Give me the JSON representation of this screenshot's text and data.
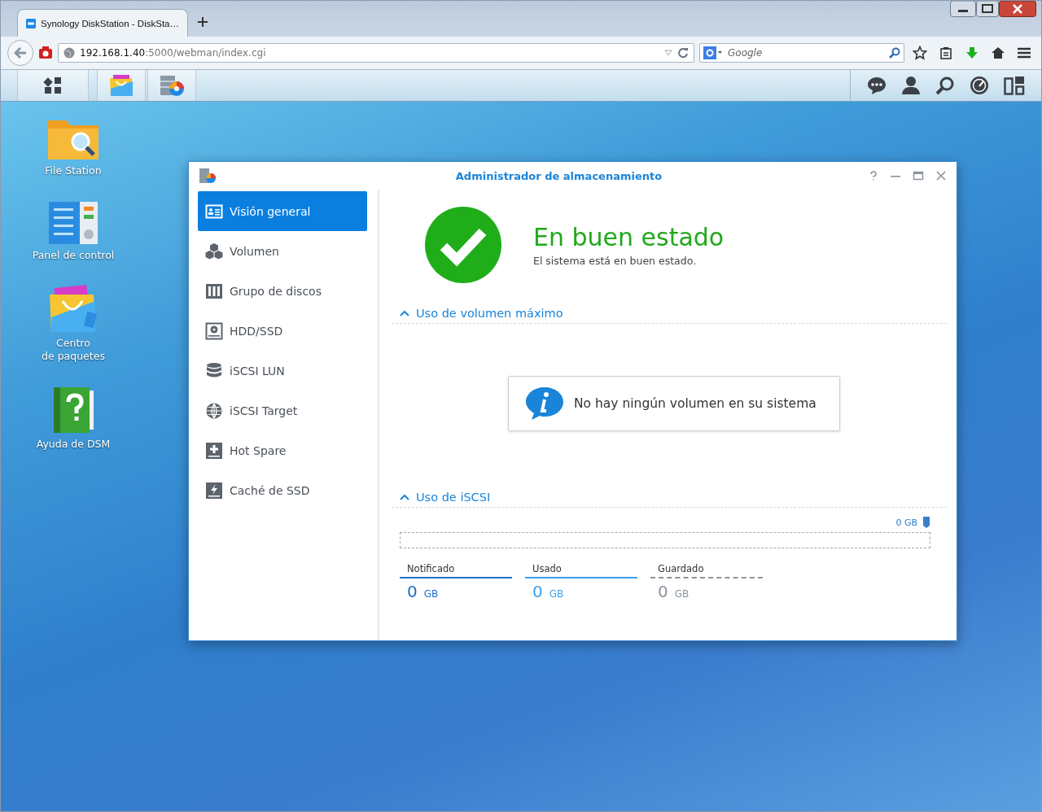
{
  "browser": {
    "tab": {
      "title": "Synology DiskStation - DiskSta…",
      "selected": true
    },
    "url": "**192.168.1.40**:5000/webman/index.cgi",
    "search": {
      "placeholder": "Google"
    }
  },
  "desktop": {
    "shortcuts": [
      {
        "label": "File Station",
        "kind": "files"
      },
      {
        "label": "Panel de control",
        "kind": "control"
      },
      {
        "label": "Centro\nde paquetes",
        "kind": "package"
      },
      {
        "label": "Ayuda de DSM",
        "kind": "help"
      }
    ]
  },
  "window": {
    "title": "Administrador de almacenamiento",
    "sidebar": {
      "items": [
        {
          "label": "Visión general",
          "kind": "overview",
          "selected": true
        },
        {
          "label": "Volumen",
          "kind": "volume",
          "selected": false
        },
        {
          "label": "Grupo de discos",
          "kind": "diskgroup",
          "selected": false
        },
        {
          "label": "HDD/SSD",
          "kind": "hdd",
          "selected": false
        },
        {
          "label": "iSCSI LUN",
          "kind": "lun",
          "selected": false
        },
        {
          "label": "iSCSI Target",
          "kind": "target",
          "selected": false
        },
        {
          "label": "Hot Spare",
          "kind": "hotspare",
          "selected": false
        },
        {
          "label": "Caché de SSD",
          "kind": "cache",
          "selected": false
        }
      ]
    },
    "status": {
      "kind": "healthy",
      "title": "En buen estado",
      "message": "El sistema está en buen estado."
    },
    "volume_usage": {
      "title": "Uso de volumen máximo",
      "expanded": true,
      "message": "No hay ningún volumen en su sistema"
    },
    "iscsi_usage": {
      "title": "Uso de iSCSI",
      "expanded": true,
      "bar_label": "0 GB",
      "legend": [
        {
          "label": "Notificado",
          "value": "0",
          "unit": "GB",
          "color": "#1f6fc5",
          "kind": "solid"
        },
        {
          "label": "Usado",
          "value": "0",
          "unit": "GB",
          "color": "#3aa0ec",
          "kind": "solid"
        },
        {
          "label": "Guardado",
          "value": "0",
          "unit": "GB",
          "color": "#8a949e",
          "kind": "dashed"
        }
      ]
    }
  }
}
